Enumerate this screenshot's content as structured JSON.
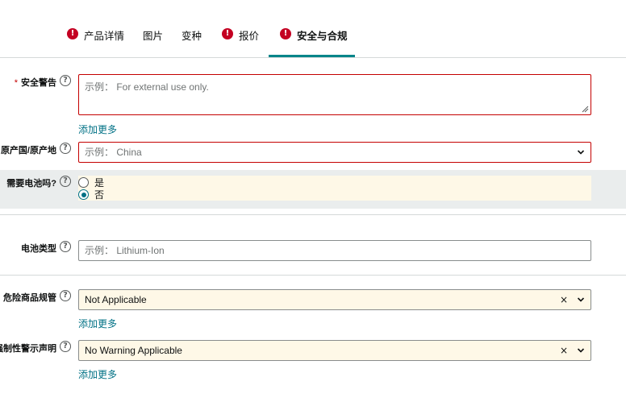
{
  "tabs": [
    {
      "label": "产品详情",
      "error": true,
      "error_icon": "!",
      "active": false
    },
    {
      "label": "图片",
      "error": false,
      "active": false
    },
    {
      "label": "变种",
      "error": false,
      "active": false
    },
    {
      "label": "报价",
      "error": true,
      "error_icon": "!",
      "active": false
    },
    {
      "label": "安全与合规",
      "error": true,
      "error_icon": "!",
      "active": true
    }
  ],
  "help_glyph": "?",
  "fields": {
    "safety_warning": {
      "required_mark": "*",
      "label": "安全警告",
      "placeholder": "示例： For external use only.",
      "add_more": "添加更多"
    },
    "country_of_origin": {
      "label": "原产国/原产地",
      "placeholder": "示例： China"
    },
    "batteries_required": {
      "label": "需要电池吗?",
      "options": [
        "是",
        "否"
      ],
      "selected": "否"
    },
    "battery_type": {
      "label": "电池类型",
      "placeholder": "示例： Lithium-Ion"
    },
    "dangerous_goods": {
      "label": "危险商品规管",
      "value": "Not Applicable",
      "add_more": "添加更多"
    },
    "warning_statement": {
      "label": "强制性警示声明",
      "value": "No Warning Applicable",
      "add_more": "添加更多"
    }
  },
  "clear_glyph": "×",
  "colors": {
    "accent": "#00858a",
    "error": "#c40000",
    "link": "#007185",
    "filled_bg": "#fef8e7",
    "band_bg": "#eaeded"
  }
}
